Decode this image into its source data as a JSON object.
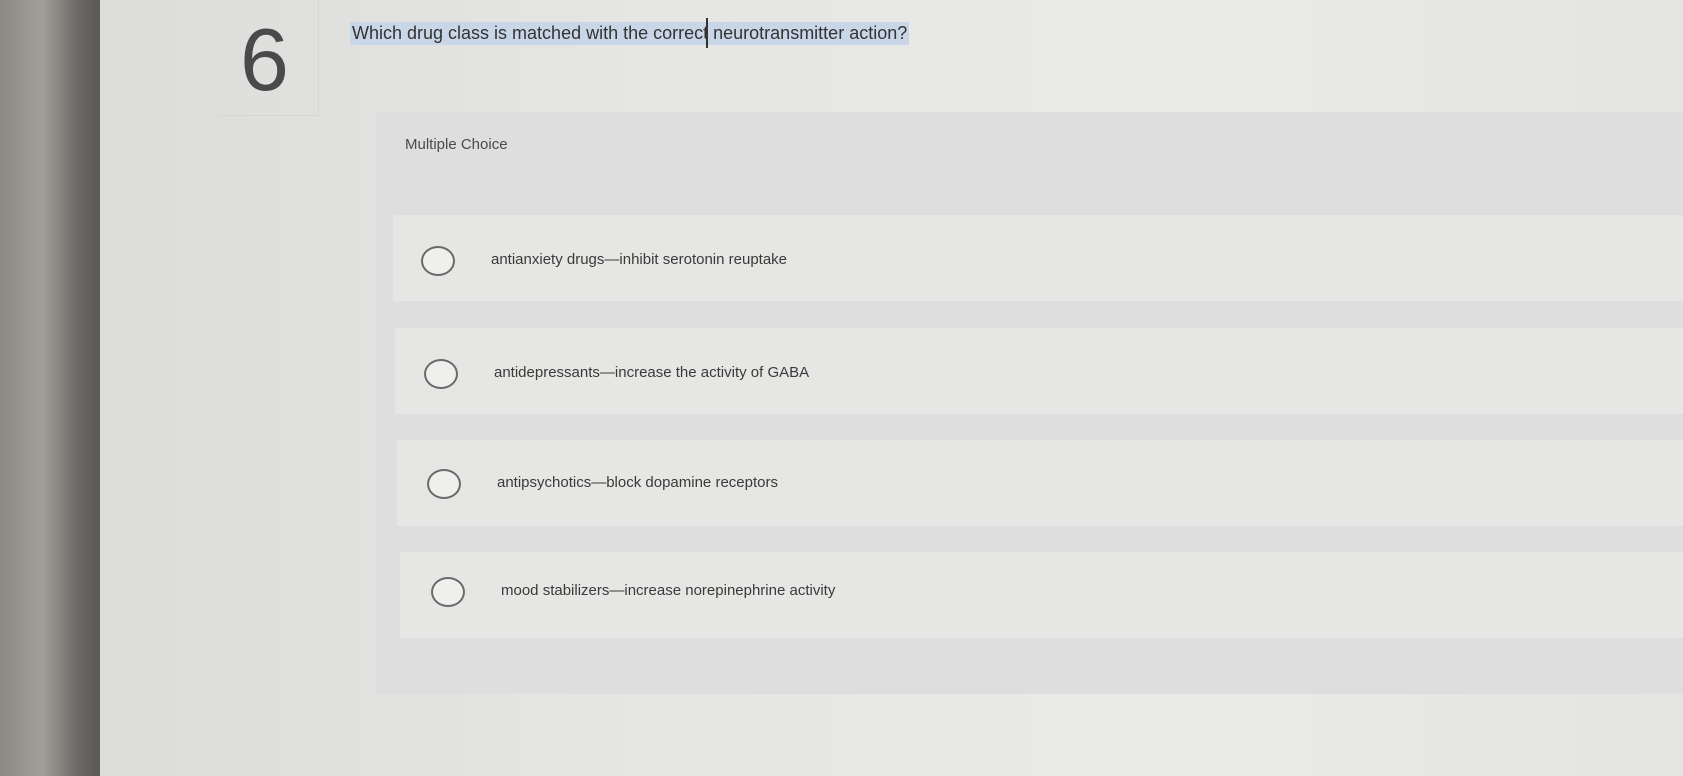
{
  "question": {
    "number": "6",
    "text": "Which drug class is matched with the correct neurotransmitter action?"
  },
  "section_label": "Multiple Choice",
  "options": [
    {
      "label": "antianxiety drugs—inhibit serotonin reuptake"
    },
    {
      "label": "antidepressants—increase the activity of GABA"
    },
    {
      "label": "antipsychotics—block dopamine receptors"
    },
    {
      "label": "mood stabilizers—increase norepinephrine activity"
    }
  ],
  "colors": {
    "selection_highlight": "#c9d6e8",
    "panel_background": "#dedede"
  }
}
